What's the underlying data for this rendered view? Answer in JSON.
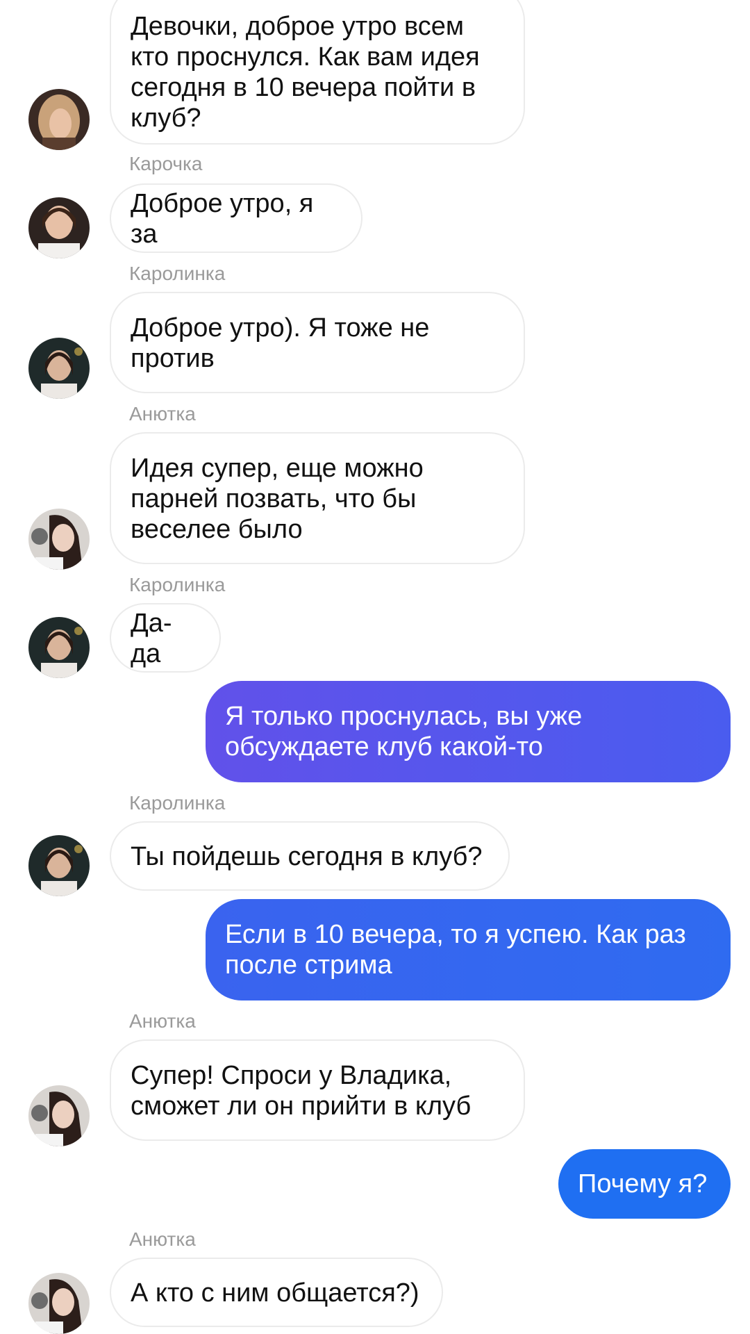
{
  "colors": {
    "outgoing_gradient_start": "#6151ea",
    "outgoing_gradient_end": "#3a63ef",
    "outgoing_blue": "#2f6bf0",
    "outgoing_solid": "#1f6ff2",
    "sender_name": "#9a9a9a",
    "incoming_border": "#ebebeb"
  },
  "messages": [
    {
      "direction": "in",
      "sender": "",
      "text": "Девочки, доброе утро всем кто проснулся. Как вам идея сегодня в 10 вечера пойти в клуб?",
      "avatar": "avatar-blonde"
    },
    {
      "direction": "in",
      "sender": "Карочка",
      "text": "Доброе утро, я за",
      "avatar": "avatar-karochka"
    },
    {
      "direction": "in",
      "sender": "Каролинка",
      "text": "Доброе утро). Я тоже не против",
      "avatar": "avatar-karolinka"
    },
    {
      "direction": "in",
      "sender": "Анютка",
      "text": "Идея супер, еще можно парней позвать, что бы веселее было",
      "avatar": "avatar-anyutka"
    },
    {
      "direction": "in",
      "sender": "Каролинка",
      "text": "Да-да",
      "avatar": "avatar-karolinka"
    },
    {
      "direction": "out",
      "sender": "",
      "text": "Я только проснулась, вы уже обсуждаете клуб какой-то",
      "avatar": ""
    },
    {
      "direction": "in",
      "sender": "Каролинка",
      "text": "Ты пойдешь сегодня в клуб?",
      "avatar": "avatar-karolinka"
    },
    {
      "direction": "out",
      "sender": "",
      "text": "Если в 10 вечера, то я успею. Как раз после стрима",
      "avatar": ""
    },
    {
      "direction": "in",
      "sender": "Анютка",
      "text": "Супер! Спроси у Владика, сможет ли он прийти в клуб",
      "avatar": "avatar-anyutka"
    },
    {
      "direction": "out",
      "sender": "",
      "text": "Почему я?",
      "avatar": ""
    },
    {
      "direction": "in",
      "sender": "Анютка",
      "text": "А кто с ним общается?)",
      "avatar": "avatar-anyutka"
    }
  ]
}
